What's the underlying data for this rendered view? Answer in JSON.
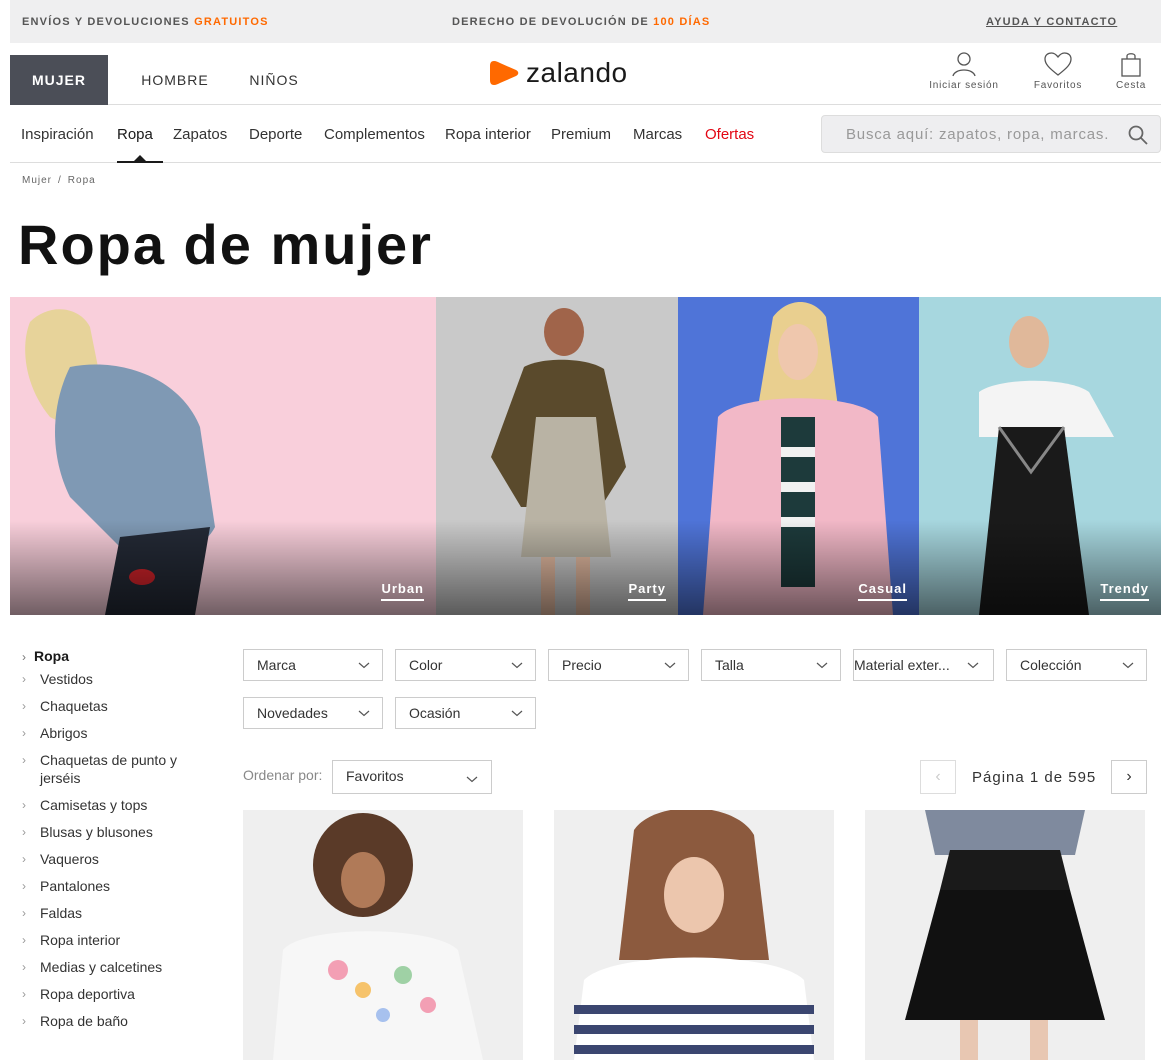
{
  "topbar": {
    "shipping_prefix": "ENVÍOS Y DEVOLUCIONES ",
    "shipping_highlight": "GRATUITOS",
    "return_prefix": "DERECHO DE DEVOLUCIÓN DE ",
    "return_highlight": "100 DÍAS",
    "help": "AYUDA Y CONTACTO"
  },
  "header": {
    "genders": [
      "MUJER",
      "HOMBRE",
      "NIÑOS"
    ],
    "logo": "zalando",
    "login": "Iniciar sesión",
    "favorites": "Favoritos",
    "cart": "Cesta"
  },
  "nav": {
    "items": [
      "Inspiración",
      "Ropa",
      "Zapatos",
      "Deporte",
      "Complementos",
      "Ropa interior",
      "Premium",
      "Marcas",
      "Ofertas"
    ],
    "search_placeholder": "Busca aquí: zapatos, ropa, marcas..."
  },
  "breadcrumb": {
    "home": "Mujer",
    "separator": "/",
    "current": "Ropa"
  },
  "title": "Ropa de mujer",
  "banners": [
    "Urban",
    "Party",
    "Casual",
    "Trendy"
  ],
  "sidebar": {
    "root": "Ropa",
    "items": [
      "Vestidos",
      "Chaquetas",
      "Abrigos",
      "Chaquetas de punto y jerséis",
      "Camisetas y tops",
      "Blusas y blusones",
      "Vaqueros",
      "Pantalones",
      "Faldas",
      "Ropa interior",
      "Medias y calcetines",
      "Ropa deportiva",
      "Ropa de baño"
    ]
  },
  "filters": {
    "row1": [
      "Marca",
      "Color",
      "Precio",
      "Talla",
      "Material exter...",
      "Colección"
    ],
    "row2": [
      "Novedades",
      "Ocasión"
    ]
  },
  "sort": {
    "label": "Ordenar por:",
    "value": "Favoritos"
  },
  "pagination": {
    "text": "Página 1 de 595",
    "prev": "‹",
    "next": "›"
  },
  "colors": {
    "accent": "#ff6900",
    "dark": "#4b4e57",
    "sale": "#e30613"
  }
}
